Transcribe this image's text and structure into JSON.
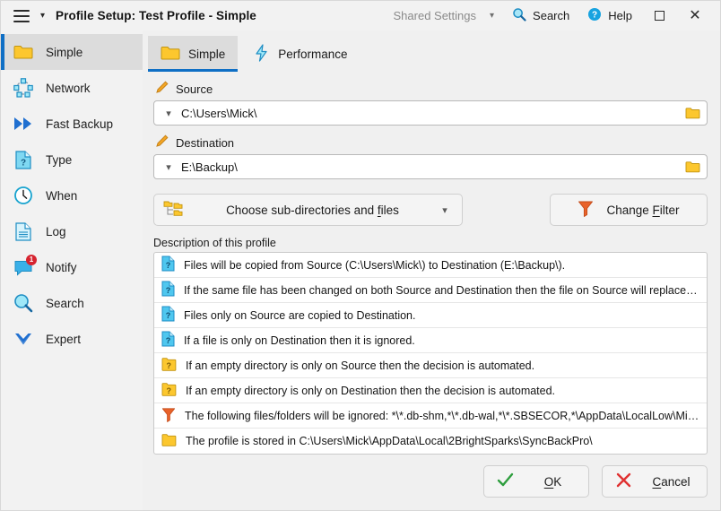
{
  "window": {
    "title": "Profile Setup: Test Profile - Simple",
    "menu_icon": "hamburger-icon",
    "title_dropdown_icon": "chevron-down-icon"
  },
  "titlebar": {
    "shared_settings_label": "Shared Settings",
    "search_label": "Search",
    "help_label": "Help",
    "maximize_label": "",
    "close_label": "✕"
  },
  "sidebar": {
    "items": [
      {
        "label": "Simple",
        "icon": "folder-icon",
        "active": true
      },
      {
        "label": "Network",
        "icon": "network-nodes-icon",
        "active": false
      },
      {
        "label": "Fast Backup",
        "icon": "fast-forward-icon",
        "active": false
      },
      {
        "label": "Type",
        "icon": "document-question-icon",
        "active": false
      },
      {
        "label": "When",
        "icon": "clock-icon",
        "active": false
      },
      {
        "label": "Log",
        "icon": "document-lines-icon",
        "active": false
      },
      {
        "label": "Notify",
        "icon": "speech-bubble-icon",
        "active": false,
        "badge": "1"
      },
      {
        "label": "Search",
        "icon": "magnifier-icon",
        "active": false
      },
      {
        "label": "Expert",
        "icon": "chevron-down-bold-icon",
        "active": false
      }
    ]
  },
  "tabs": [
    {
      "label": "Simple",
      "icon": "folder-icon",
      "active": true
    },
    {
      "label": "Performance",
      "icon": "lightning-icon",
      "active": false
    }
  ],
  "source": {
    "label": "Source",
    "label_icon": "pencil-icon",
    "value": "C:\\Users\\Mick\\",
    "dropdown_icon": "chevron-down-icon",
    "browse_icon": "folder-icon"
  },
  "destination": {
    "label": "Destination",
    "label_icon": "pencil-icon",
    "value": "E:\\Backup\\",
    "dropdown_icon": "chevron-down-icon",
    "browse_icon": "folder-icon"
  },
  "actions": {
    "choose_prefix": "Choose sub-directories and ",
    "choose_accel": "f",
    "choose_suffix": "iles",
    "choose_icon": "folder-tree-icon",
    "choose_dropdown_icon": "chevron-down-icon",
    "filter_prefix": "Change ",
    "filter_accel": "F",
    "filter_suffix": "ilter",
    "filter_icon": "funnel-icon"
  },
  "description": {
    "title": "Description of this profile",
    "rows": [
      {
        "icon": "document-question-blue-icon",
        "text": "Files will be copied from Source (C:\\Users\\Mick\\) to Destination (E:\\Backup\\)."
      },
      {
        "icon": "document-question-blue-icon",
        "text": "If the same file has been changed on both Source and Destination then the file on Source will replace the file on..."
      },
      {
        "icon": "document-question-blue-icon",
        "text": "Files only on Source are copied to Destination."
      },
      {
        "icon": "document-question-blue-icon",
        "text": "If a file is only on Destination then it is ignored."
      },
      {
        "icon": "folder-question-yellow-icon",
        "text": "If an empty directory is only on Source then the decision is automated."
      },
      {
        "icon": "folder-question-yellow-icon",
        "text": "If an empty directory is only on Destination then the decision is automated."
      },
      {
        "icon": "funnel-icon",
        "text": "The following files/folders will be ignored: *\\*.db-shm,*\\*.db-wal,*\\*.SBSECOR,*\\AppData\\LocalLow\\Microsoft\\..."
      },
      {
        "icon": "folder-icon",
        "text": "The profile is stored in C:\\Users\\Mick\\AppData\\Local\\2BrightSparks\\SyncBackPro\\"
      }
    ]
  },
  "footer": {
    "ok_accel": "O",
    "ok_suffix": "K",
    "ok_icon": "check-icon",
    "cancel_accel": "C",
    "cancel_suffix": "ancel",
    "cancel_icon": "cross-icon"
  },
  "colors": {
    "accent": "#0f6fc5",
    "folder_yellow": "#fcc72e",
    "cyan": "#4ec3e0",
    "badge_red": "#d6232f",
    "check_green": "#2e9e3e",
    "cross_red": "#e03131",
    "funnel_orange": "#e8622a"
  }
}
